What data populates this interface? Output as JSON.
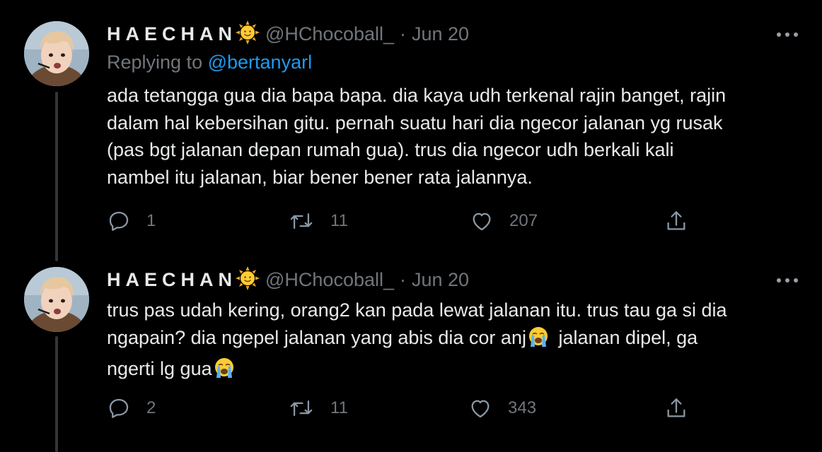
{
  "tweets": [
    {
      "display_name": "HAECHAN",
      "handle": "@HChocoball_",
      "separator": "·",
      "date": "Jun 20",
      "replying_prefix": "Replying to",
      "replying_to": "@bertanyarl",
      "lines": [
        "ada tetangga gua dia bapa bapa. dia kaya udh terkenal rajin banget, rajin",
        "dalam hal kebersihan gitu. pernah suatu hari dia ngecor jalanan yg rusak",
        "(pas bgt jalanan depan rumah gua). trus dia ngecor udh berkali kali",
        "nambel itu jalanan, biar bener bener rata jalannya."
      ],
      "replies": "1",
      "retweets": "11",
      "likes": "207"
    },
    {
      "display_name": "HAECHAN",
      "handle": "@HChocoball_",
      "separator": "·",
      "date": "Jun 20",
      "line1": "trus pas udah kering, orang2 kan pada lewat jalanan itu. trus tau ga si dia",
      "line2_a": "ngapain? dia ngepel jalanan yang abis dia cor anj",
      "line2_b": " jalanan dipel, ga",
      "line3": "ngerti lg gua",
      "replies": "2",
      "retweets": "11",
      "likes": "343"
    }
  ],
  "icons": {
    "name_emoji": "sun-with-face",
    "inline_emoji": "loudly-crying-face",
    "reply": "reply-icon",
    "retweet": "retweet-icon",
    "like": "heart-icon",
    "share": "share-icon",
    "more": "more-icon"
  },
  "colors": {
    "background": "#000000",
    "text": "#e7e9ea",
    "muted": "#71767b",
    "link": "#1d9bf0",
    "thread_line": "#333639"
  }
}
